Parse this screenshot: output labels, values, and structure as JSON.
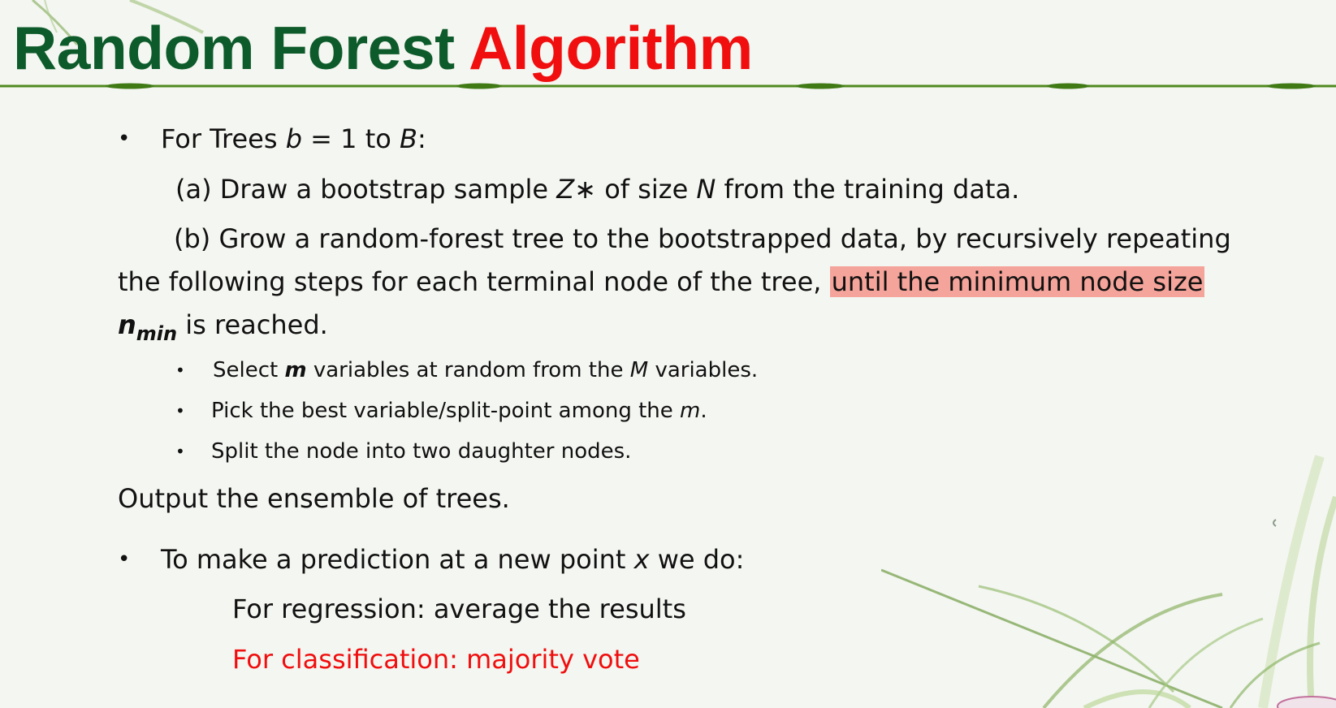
{
  "title": {
    "part1": "Random Forest",
    "part2": "Algorithm"
  },
  "colors": {
    "title_green": "#0d5b2a",
    "title_red": "#f00e0e",
    "highlight": "#f4a49a",
    "red_text": "#f00e0e"
  },
  "content": {
    "bullet1": {
      "text_a": "For Trees ",
      "var_b": "b",
      "text_b": " = 1 to ",
      "var_B": "B",
      "text_c": ":"
    },
    "step_a": {
      "text_a": "(a) Draw a bootstrap sample ",
      "var_z": "Z∗",
      "text_b": " of size ",
      "var_n": "N",
      "text_c": " from the training data."
    },
    "step_b": {
      "line1": "(b) Grow a random-forest tree  to the bootstrapped data, by recursively repeating",
      "line2_plain": "the following steps for each terminal node of the tree, ",
      "line2_highlight": "until the minimum node size",
      "line3_n": "n",
      "line3_sub": "min",
      "line3_text": " is reached."
    },
    "sub_bullets": [
      {
        "text_a": " Select ",
        "var": "m",
        "text_b": " variables at random from the ",
        "var2": "M",
        "text_c": " variables."
      },
      {
        "text_a": "Pick the best variable/split-point among the ",
        "var": "m",
        "text_b": "."
      },
      {
        "text": "Split the node into two daughter nodes."
      }
    ],
    "output": "Output the ensemble of trees.",
    "bullet2": {
      "text_a": "To make a prediction at a new point ",
      "var_x": "x",
      "text_b": " we do:"
    },
    "regression": "For regression: average the results",
    "classification": "For classification: majority vote"
  },
  "bullet_symbol": "•"
}
